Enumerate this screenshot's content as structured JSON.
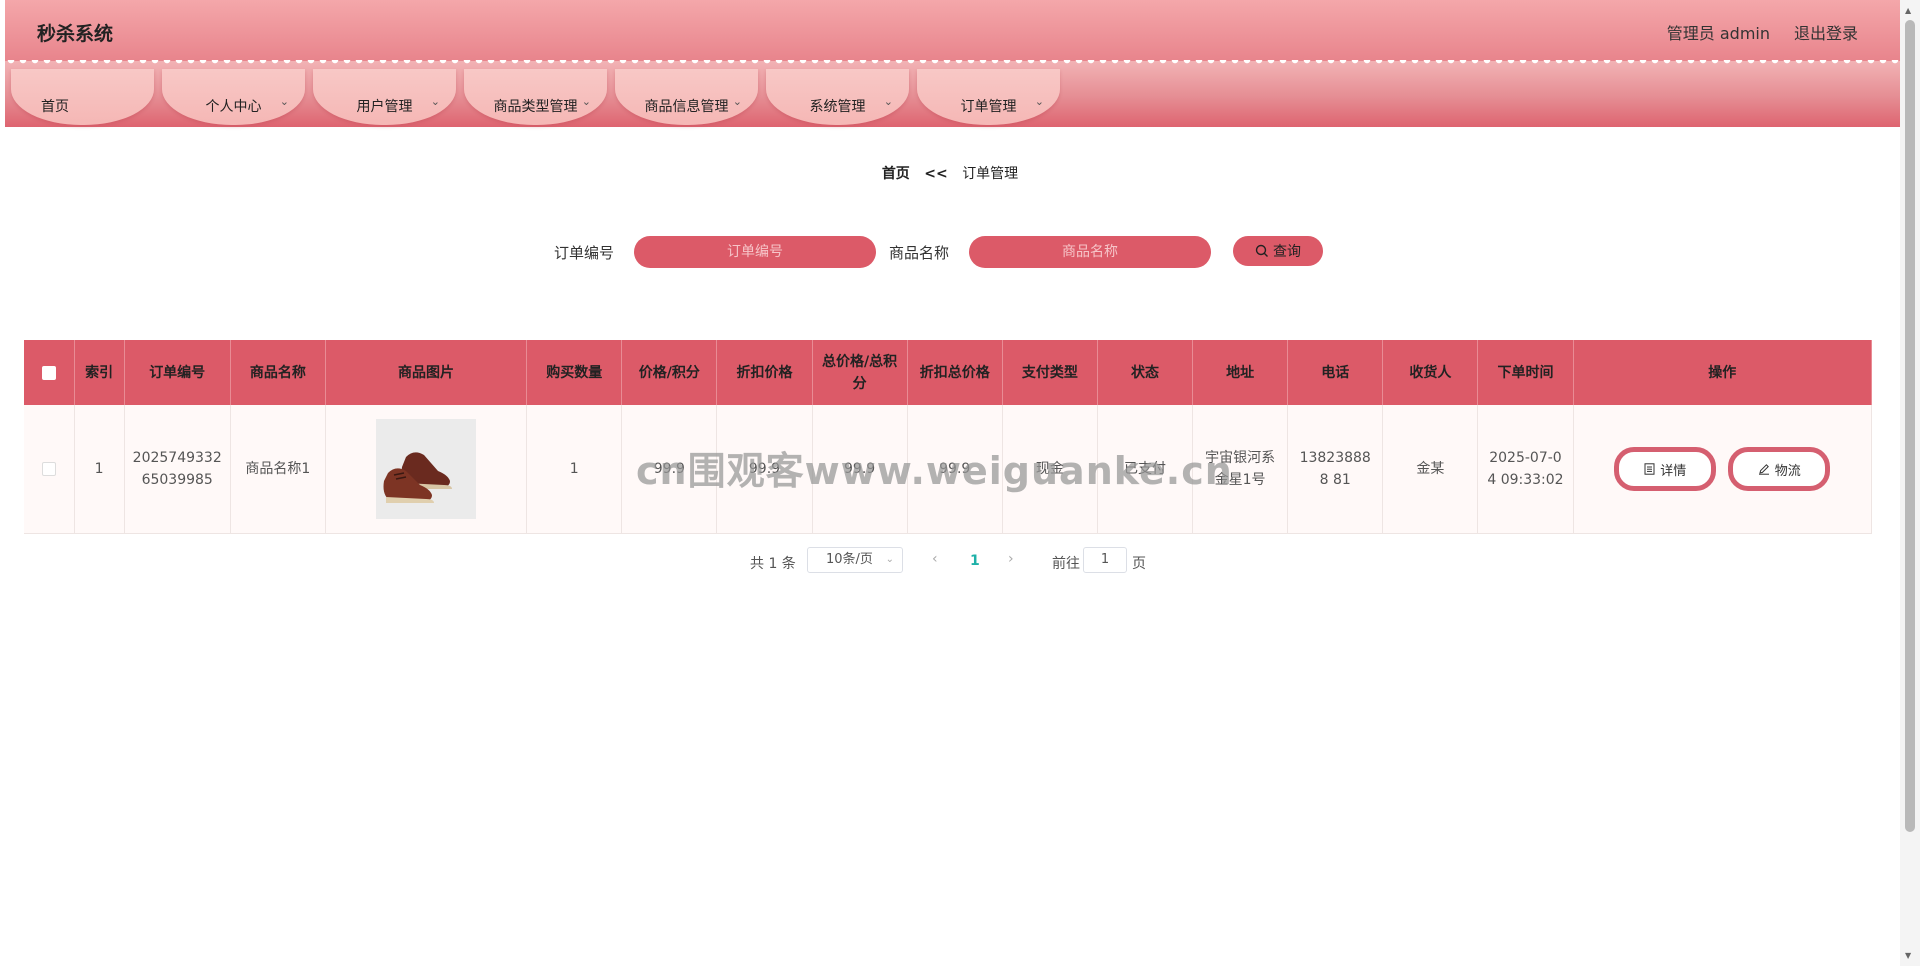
{
  "header": {
    "title": "秒杀系统",
    "user": "管理员 admin",
    "logout": "退出登录"
  },
  "nav": [
    {
      "label": "首页",
      "dropdown": false
    },
    {
      "label": "个人中心",
      "dropdown": true
    },
    {
      "label": "用户管理",
      "dropdown": true
    },
    {
      "label": "商品类型管理",
      "dropdown": true
    },
    {
      "label": "商品信息管理",
      "dropdown": true
    },
    {
      "label": "系统管理",
      "dropdown": true
    },
    {
      "label": "订单管理",
      "dropdown": true
    }
  ],
  "breadcrumb": {
    "home": "首页",
    "sep": "<<",
    "current": "订单管理"
  },
  "search": {
    "order_label": "订单编号",
    "order_placeholder": "订单编号",
    "goods_label": "商品名称",
    "goods_placeholder": "商品名称",
    "button": "查询"
  },
  "table": {
    "headers": [
      "索引",
      "订单编号",
      "商品名称",
      "商品图片",
      "购买数量",
      "价格/积分",
      "折扣价格",
      "总价格/总积分",
      "折扣总价格",
      "支付类型",
      "状态",
      "地址",
      "电话",
      "收货人",
      "下单时间",
      "操作"
    ],
    "rows": [
      {
        "index": "1",
        "order_no": "2025749332 65039985",
        "goods_name": "商品名称1",
        "quantity": "1",
        "price": "99.9",
        "discount_price": "99.9",
        "total_price": "99.9",
        "discount_total": "99.9",
        "pay_type": "现金",
        "status": "已支付",
        "address": "宇宙银河系金星1号",
        "phone": "138238888 81",
        "receiver": "金某",
        "order_time": "2025-07-0 4 09:33:02",
        "detail_btn": "详情",
        "logistics_btn": "物流"
      }
    ]
  },
  "pager": {
    "total": "共 1 条",
    "page_size": "10条/页",
    "current": "1",
    "goto": "前往",
    "jump_value": "1",
    "unit": "页"
  },
  "watermark": "cn围观客www.weiguanke.cn",
  "colors": {
    "accent": "#dc5a68",
    "header": "#e8848c",
    "page_active": "#1eb1a8"
  }
}
